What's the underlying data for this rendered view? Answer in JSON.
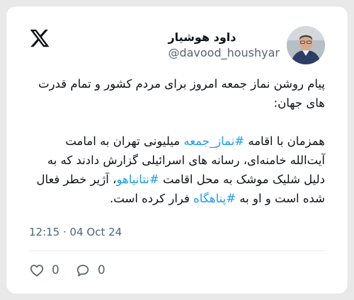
{
  "author": {
    "display_name": "داود هوشیار",
    "handle": "@davood_houshyar"
  },
  "tweet": {
    "line1": "پیام روشن نماز جمعه امروز برای مردم کشور و تمام قدرت های جهان:",
    "p2_a": "همزمان با اقامه ",
    "tag1": "#نماز_جمعه",
    "p2_b": " میلیونی تهران به امامت آیت‌الله خامنه‌ای، رسانه های اسرائیلی گزارش دادند که به دلیل شلیک موشک به محل اقامت ",
    "tag2": "#نتانیاهو",
    "p2_c": "، آژیر خطر فعال شده است و او به ",
    "tag3": "#پناهگاه",
    "p2_d": " فرار کرده است."
  },
  "timestamp": "12:15 · 04 Oct 24",
  "actions": {
    "likes": "0",
    "replies": "0"
  },
  "colors": {
    "hashtag": "#1d9bf0",
    "text": "#0f1419",
    "muted": "#536471"
  },
  "icons": [
    "x-logo-icon",
    "heart-icon",
    "reply-bubble-icon"
  ]
}
